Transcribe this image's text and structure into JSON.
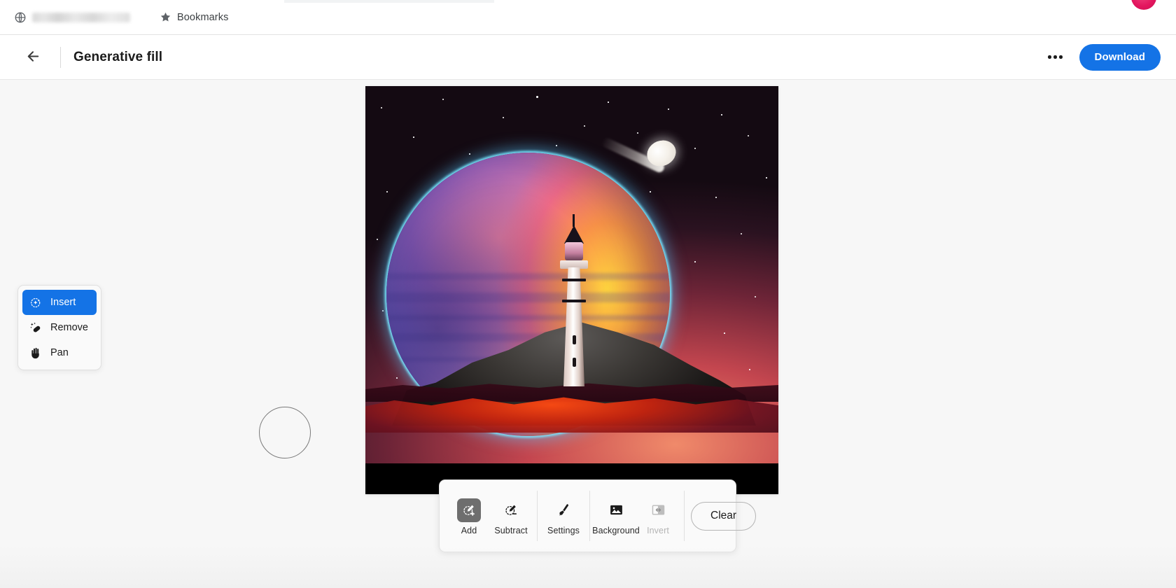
{
  "browser": {
    "bookmark_globe_icon": "globe-icon",
    "redacted_bookmark_label": "",
    "bookmarks_star_icon": "star-icon",
    "bookmarks_label": "Bookmarks",
    "avatar_color": "#e3175f"
  },
  "header": {
    "back_icon": "arrow-left-icon",
    "title": "Generative fill",
    "more_icon": "more-horizontal-icon",
    "download_label": "Download",
    "accent_color": "#1473e6"
  },
  "tool_panel": {
    "items": [
      {
        "label": "Insert",
        "icon": "magic-wand-select-icon",
        "selected": true
      },
      {
        "label": "Remove",
        "icon": "healing-brush-icon",
        "selected": false
      },
      {
        "label": "Pan",
        "icon": "hand-icon",
        "selected": false
      }
    ]
  },
  "canvas": {
    "brush_cursor": "brush-cursor-circle",
    "artwork_alt": "Lighthouse on a rocky outcrop before a large multicolored planet and comet in a starfield"
  },
  "bottom_toolbar": {
    "selection_tools": [
      {
        "label": "Add",
        "icon": "selection-add-icon",
        "active": true,
        "disabled": false
      },
      {
        "label": "Subtract",
        "icon": "selection-subtract-icon",
        "active": false,
        "disabled": false
      }
    ],
    "brush_tools": [
      {
        "label": "Settings",
        "icon": "brush-icon",
        "active": false,
        "disabled": false
      }
    ],
    "mask_tools": [
      {
        "label": "Background",
        "icon": "image-icon",
        "active": false,
        "disabled": false
      },
      {
        "label": "Invert",
        "icon": "invert-icon",
        "active": false,
        "disabled": true
      }
    ],
    "clear_label": "Clear"
  }
}
